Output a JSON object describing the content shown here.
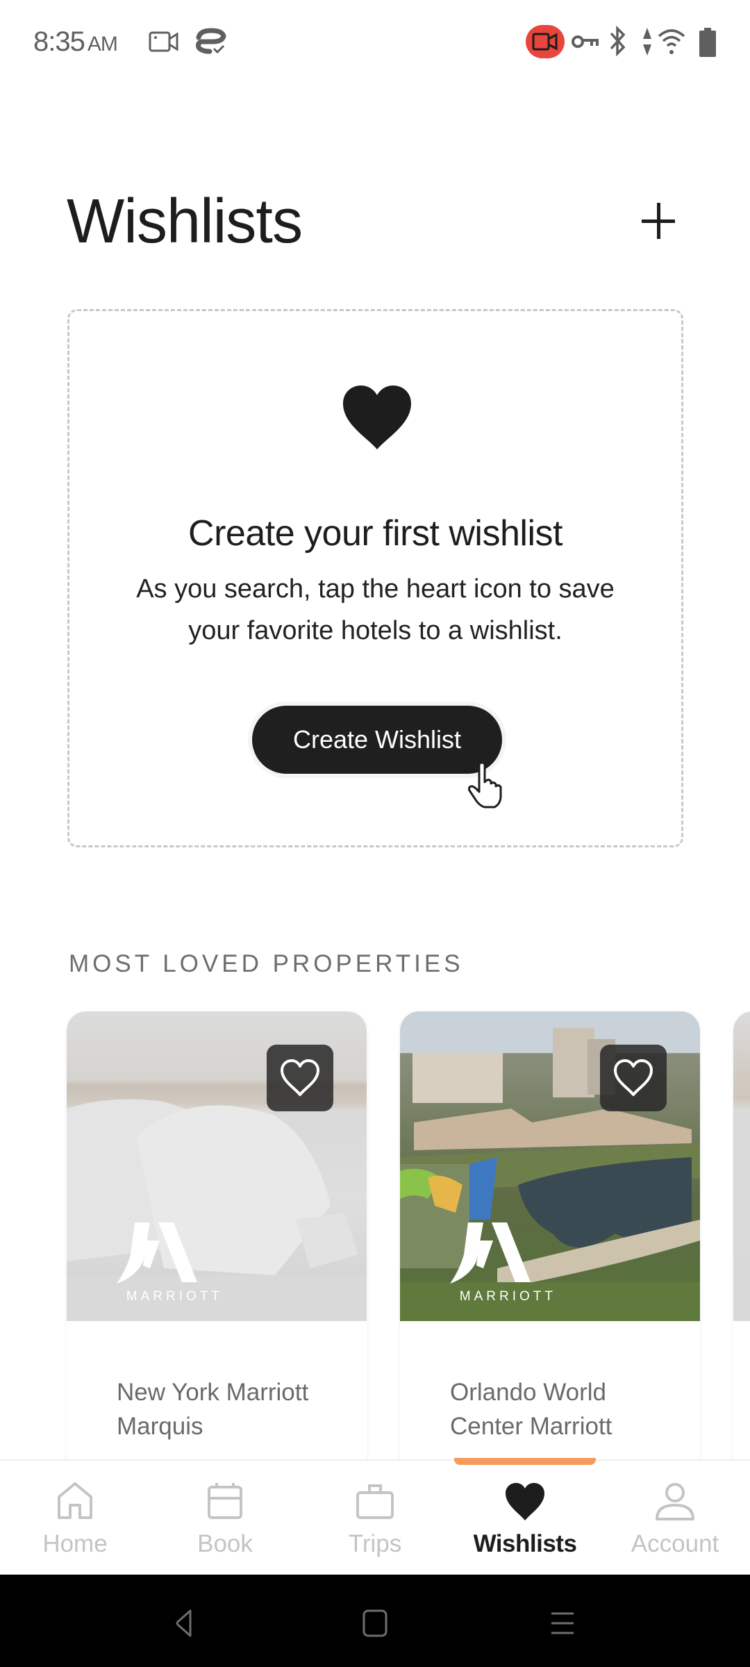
{
  "status_bar": {
    "time": "8:35",
    "ampm": "AM",
    "left_icons": [
      "screen-record-icon",
      "vpn-cloud-check-icon"
    ],
    "right_icons": [
      "recording-active-icon",
      "key-icon",
      "bluetooth-icon",
      "data-arrows-icon",
      "wifi-icon",
      "battery-icon"
    ],
    "recording_color": "#e8453c"
  },
  "header": {
    "title": "Wishlists",
    "add_label": "+"
  },
  "empty_state": {
    "icon": "heart-icon",
    "title": "Create your first wishlist",
    "description": "As you search, tap the heart icon to save your favorite hotels to a wishlist.",
    "button_label": "Create Wishlist"
  },
  "most_loved": {
    "label": "MOST LOVED PROPERTIES",
    "properties": [
      {
        "name": "New York Marriott Marquis",
        "brand": "MARRIOTT",
        "favorite": false
      },
      {
        "name": "Orlando World Center Marriott",
        "brand": "MARRIOTT",
        "favorite": false
      },
      {
        "name": "",
        "brand": "",
        "favorite": false
      }
    ]
  },
  "tab_bar": {
    "accent_color": "#f39a5c",
    "active_index": 3,
    "tabs": [
      {
        "label": "Home",
        "icon": "home-icon"
      },
      {
        "label": "Book",
        "icon": "calendar-icon"
      },
      {
        "label": "Trips",
        "icon": "briefcase-icon"
      },
      {
        "label": "Wishlists",
        "icon": "heart-icon"
      },
      {
        "label": "Account",
        "icon": "person-icon"
      }
    ]
  },
  "system_nav": {
    "buttons": [
      "back",
      "home",
      "recents"
    ]
  }
}
